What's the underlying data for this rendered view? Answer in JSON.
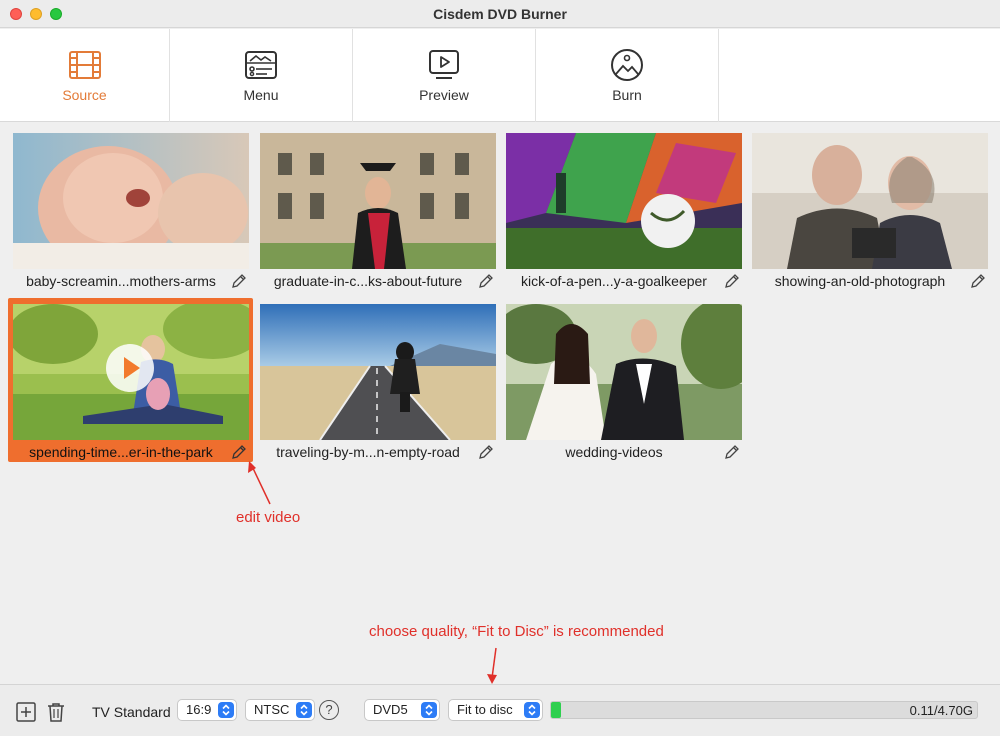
{
  "window": {
    "title": "Cisdem DVD Burner"
  },
  "toolbar": {
    "tabs": [
      {
        "label": "Source",
        "icon": "film-icon",
        "active": true
      },
      {
        "label": "Menu",
        "icon": "menu-icon",
        "active": false
      },
      {
        "label": "Preview",
        "icon": "play-icon",
        "active": false
      },
      {
        "label": "Burn",
        "icon": "disc-icon",
        "active": false
      }
    ],
    "accent": "#e37b38"
  },
  "videos": [
    {
      "title": "baby-screamin...mothers-arms",
      "selected": false
    },
    {
      "title": "graduate-in-c...ks-about-future",
      "selected": false
    },
    {
      "title": "kick-of-a-pen...y-a-goalkeeper",
      "selected": false
    },
    {
      "title": "showing-an-old-photograph",
      "selected": false
    },
    {
      "title": "spending-time...er-in-the-park",
      "selected": true
    },
    {
      "title": "traveling-by-m...n-empty-road",
      "selected": false
    },
    {
      "title": "wedding-videos",
      "selected": false
    }
  ],
  "annotations": {
    "edit_video": "edit video",
    "quality_hint": "choose quality, “Fit to Disc” is recommended",
    "color": "#e0302a"
  },
  "bottombar": {
    "tv_standard_label": "TV Standard",
    "aspect": "16:9",
    "standard": "NTSC",
    "help": "?",
    "disc_type": "DVD5",
    "quality": "Fit to disc",
    "usage_text": "0.11/4.70G",
    "usage_fraction": 0.0234
  }
}
